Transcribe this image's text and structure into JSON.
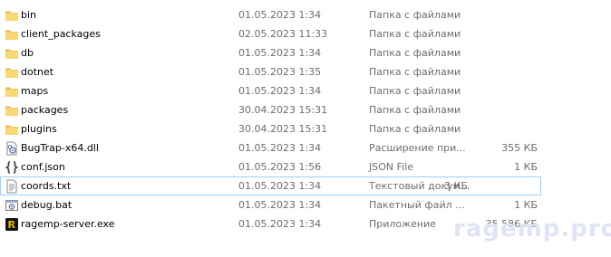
{
  "files": [
    {
      "name": "bin",
      "date": "01.05.2023 1:34",
      "type": "Папка с файлами",
      "size": "",
      "icon": "folder-icon"
    },
    {
      "name": "client_packages",
      "date": "02.05.2023 11:33",
      "type": "Папка с файлами",
      "size": "",
      "icon": "folder-icon"
    },
    {
      "name": "db",
      "date": "01.05.2023 1:34",
      "type": "Папка с файлами",
      "size": "",
      "icon": "folder-icon"
    },
    {
      "name": "dotnet",
      "date": "01.05.2023 1:35",
      "type": "Папка с файлами",
      "size": "",
      "icon": "folder-icon"
    },
    {
      "name": "maps",
      "date": "01.05.2023 1:34",
      "type": "Папка с файлами",
      "size": "",
      "icon": "folder-icon"
    },
    {
      "name": "packages",
      "date": "30.04.2023 15:31",
      "type": "Папка с файлами",
      "size": "",
      "icon": "folder-icon"
    },
    {
      "name": "plugins",
      "date": "30.04.2023 15:31",
      "type": "Папка с файлами",
      "size": "",
      "icon": "folder-icon"
    },
    {
      "name": "BugTrap-x64.dll",
      "date": "01.05.2023 1:34",
      "type": "Расширение при...",
      "size": "355 КБ",
      "icon": "dll-file-icon"
    },
    {
      "name": "conf.json",
      "date": "01.05.2023 1:56",
      "type": "JSON File",
      "size": "1 КБ",
      "icon": "json-file-icon"
    },
    {
      "name": "coords.txt",
      "date": "01.05.2023 1:34",
      "type": "Текстовый докум...",
      "size": "3 КБ",
      "icon": "text-file-icon"
    },
    {
      "name": "debug.bat",
      "date": "01.05.2023 1:34",
      "type": "Пакетный файл ...",
      "size": "1 КБ",
      "icon": "batch-file-icon"
    },
    {
      "name": "ragemp-server.exe",
      "date": "01.05.2023 1:34",
      "type": "Приложение",
      "size": "35 586 КБ",
      "icon": "ragemp-exe-icon"
    }
  ],
  "selected_index": 9,
  "watermark": "ragemp.pro",
  "colors": {
    "folder": "#f8d775",
    "folder_dark": "#e8b84a",
    "selection_border": "#99d1ff",
    "secondary_text": "#6d6d6d",
    "watermark": "#dfe3f5"
  }
}
